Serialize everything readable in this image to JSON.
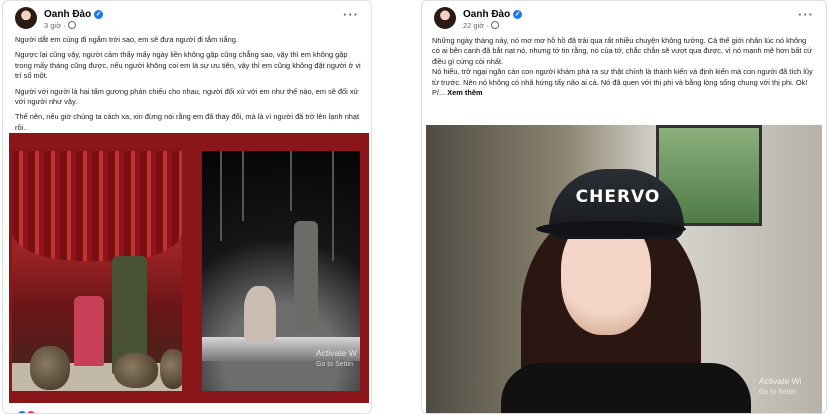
{
  "posts": [
    {
      "author": "Oanh Đào",
      "time": "3 giờ",
      "paragraphs": [
        "Người dắt em cùng đi ngắm trời sao, em sẽ đưa người đi tắm nắng.",
        "Ngược lại cũng vậy, người cảm thấy mấy ngày liền không gặp cũng chẳng sao, vậy thì em không gặp trong mấy tháng cũng được, nếu người không coi em là sự ưu tiên, vậy thì em cũng không đặt người ở vị trí số một.",
        "Người với người là hai tấm gương phản chiếu cho nhau, người đối xử với em như thế nào, em sẽ đối xử với người như vậy.",
        "Thế nên, nếu giờ chúng ta cách xa, xin đừng nói rằng em đã thay đổi, mà là vì người đã trở lên lạnh nhạt rồi."
      ]
    },
    {
      "author": "Oanh Đào",
      "time": "22 giờ",
      "paragraphs": [
        "Những ngày tháng này, nó mơ mơ hồ hồ đã trải qua rất nhiều chuyện không tưởng. Cả thế giới nhân lúc nó không có ai bên cạnh đã bắt nạt nó, nhưng tớ tin rằng, nó của tớ, chắc chắn sẽ vượt qua được, vì nó mạnh mẽ hơn bất cứ điều gì cứng cỏi nhất.",
        "Nó hiểu, trở ngại ngăn cản con người khám phá ra sự thật chính là thành kiến và định kiến mà con người đã tích lũy từ trước.  Nên nó không có nhã hứng tấy não ai cả. Nó đã quen với thị phi và bằng lòng sống chung với thị phi. Ok!",
        "P/..."
      ],
      "see_more": "Xem thêm"
    }
  ],
  "cap_brand": "CHERVO",
  "watermark": {
    "line1": "Activate W",
    "line2": "Go to Settin"
  },
  "watermark_right": {
    "line1": "Activate Wi",
    "line2": "Go to Settin"
  },
  "icons": [
    "verified-badge-icon",
    "globe-icon",
    "more-options-icon"
  ],
  "colors": {
    "accent": "#1877f2",
    "frame_red": "#8b1619"
  }
}
